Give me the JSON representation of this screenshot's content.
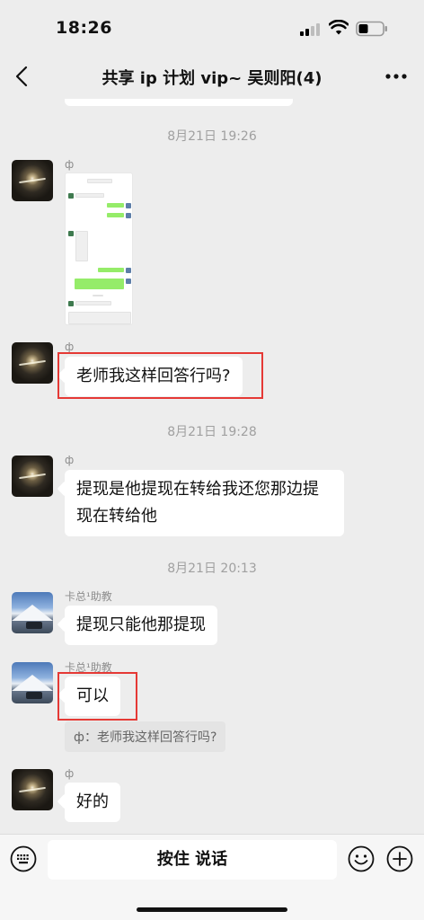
{
  "status_bar": {
    "time": "18:26"
  },
  "nav": {
    "title": "共享 ip 计划 vip~ 吴则阳(4)"
  },
  "chat": {
    "timestamps": [
      "8月21日 19:26",
      "8月21日 19:28",
      "8月21日 20:13"
    ],
    "messages": [
      {
        "sender": "ф",
        "type": "image",
        "image_label": "image-message"
      },
      {
        "sender": "ф",
        "text": "老师我这样回答行吗?",
        "highlighted": true
      },
      {
        "sender": "ф",
        "text_line1": "提现是他提现在转给我还您那边提",
        "text_line2": "现在转给他"
      },
      {
        "sender": "卡总¹助教",
        "text": "提现只能他那提现"
      },
      {
        "sender": "卡总¹助教",
        "text": "可以",
        "highlighted": true,
        "quote": "ф：老师我这样回答行吗?"
      },
      {
        "sender": "ф",
        "text": "好的"
      }
    ]
  },
  "input_bar": {
    "hold_to_talk_label": "按住 说话"
  },
  "colors": {
    "highlight_border": "#e53935",
    "background": "#ededed",
    "bubble": "#ffffff"
  }
}
